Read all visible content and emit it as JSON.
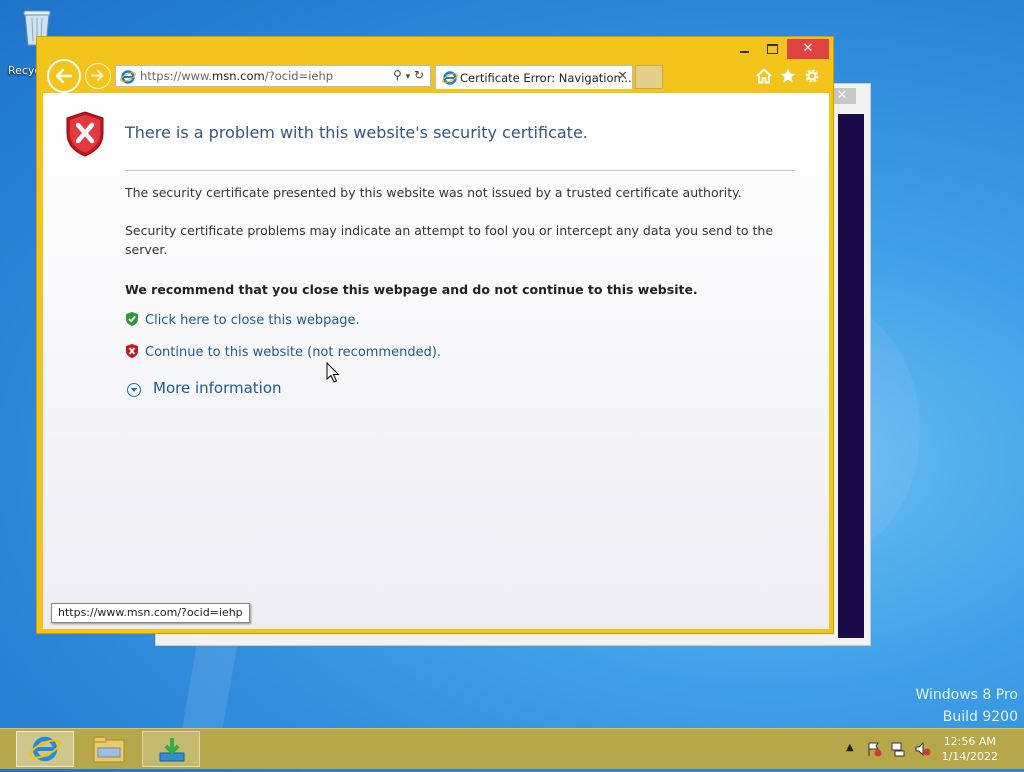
{
  "desktop": {
    "recycle_label": "Recyc",
    "watermark_line1": "Windows 8 Pro",
    "watermark_line2": "Build 9200"
  },
  "browser": {
    "address": {
      "prefix": "https://www.",
      "domain": "msn.com",
      "suffix": "/?ocid=iehp"
    },
    "tab_title": "Certificate Error: Navigation...",
    "tab_close": "✕",
    "window_close": "✕",
    "status_url": "https://www.msn.com/?ocid=iehp"
  },
  "page": {
    "heading": "There is a problem with this website's security certificate.",
    "p1": "The security certificate presented by this website was not issued by a trusted certificate authority.",
    "p2": "Security certificate problems may indicate an attempt to fool you or intercept any data you send to the server.",
    "p3": "We recommend that you close this webpage and do not continue to this website.",
    "close_link": "Click here to close this webpage.",
    "continue_link": "Continue to this website (not recommended).",
    "more_info": "More information"
  },
  "taskbar": {
    "time": "12:56 AM",
    "date": "1/14/2022"
  },
  "colors": {
    "ie_frame": "#f2c41c",
    "link": "#1b5d91",
    "heading": "#33577d",
    "close_red": "#e04343"
  }
}
